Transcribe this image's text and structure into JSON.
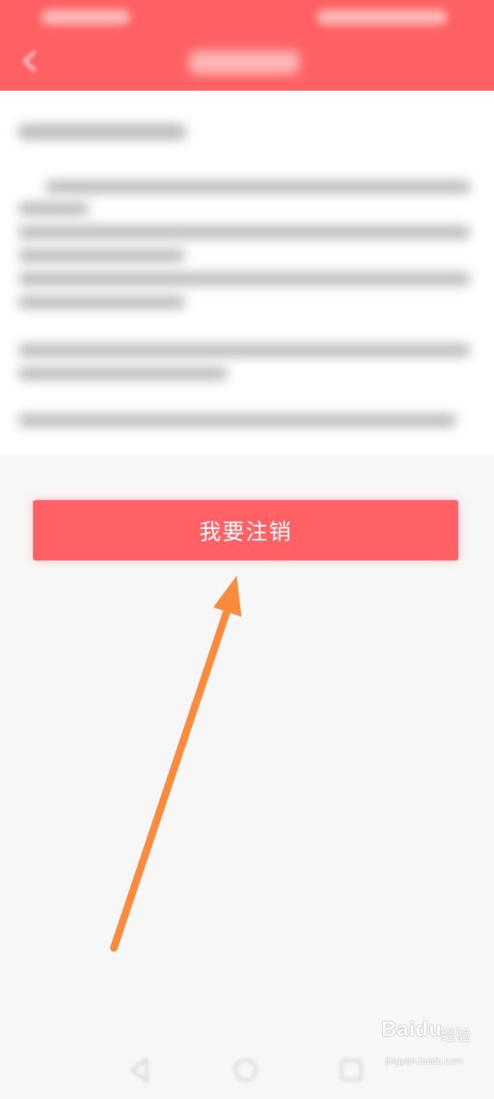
{
  "primary_action": {
    "label": "我要注销"
  },
  "colors": {
    "accent": "#fe6163",
    "button": "#ff6164",
    "annotation_arrow": "#f98b3a",
    "background": "#f7f7f7"
  },
  "icons": {
    "back": "chevron-left-icon",
    "nav_back": "triangle-back-icon",
    "nav_home": "circle-home-icon",
    "nav_recent": "square-recent-icon"
  },
  "watermark": {
    "brand": "Baidu",
    "sub": "经验",
    "url": "jingyan.baidu.com"
  }
}
